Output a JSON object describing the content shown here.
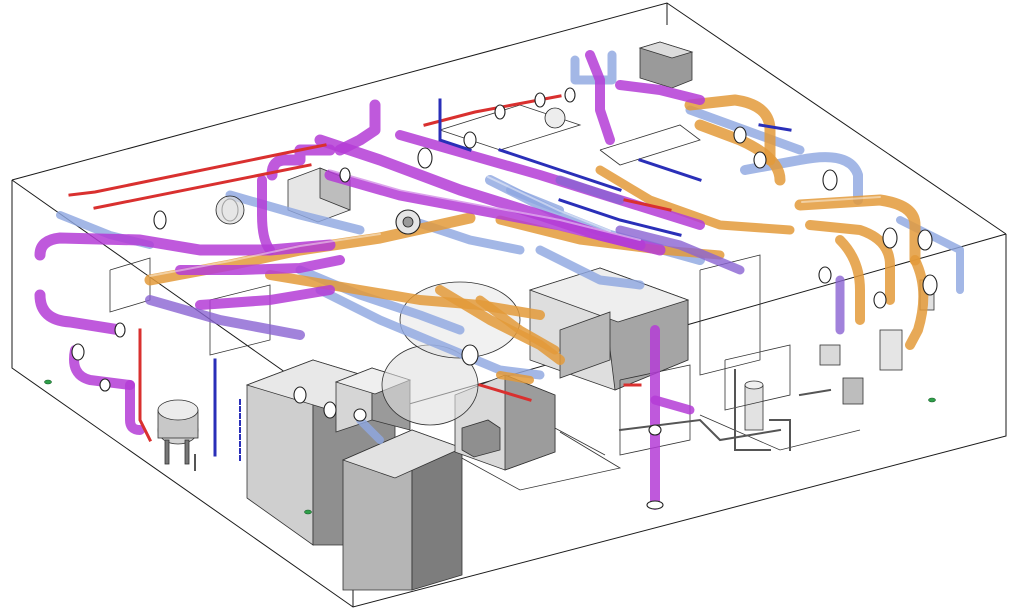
{
  "scene": {
    "colors": {
      "background": "#ffffff",
      "enclosure_edge": "#1a1a1a",
      "equipment_light": "#e6e6e6",
      "equipment_mid": "#bdbdbd",
      "equipment_dark": "#8a8a8a",
      "pipe_magenta": "#b43cd6",
      "pipe_violet": "#8a63d2",
      "pipe_light_blue": "#8fa7e0",
      "pipe_orange": "#e39a3a",
      "pipe_red": "#d9302f",
      "pipe_navy": "#2a2fb8",
      "floor_marker_green": "#2fa04a"
    },
    "icons": [
      "valve-flange-icon",
      "pump-unit-icon",
      "floor-drain-icon"
    ]
  }
}
